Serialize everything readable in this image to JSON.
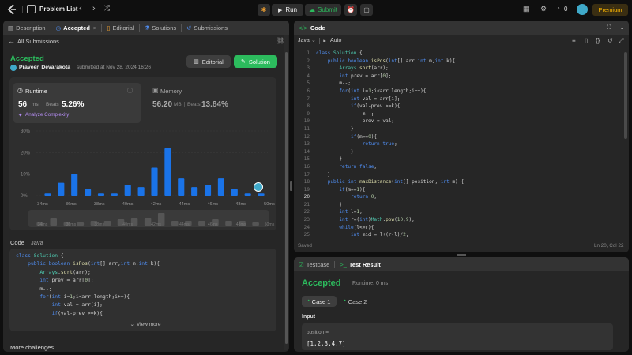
{
  "topbar": {
    "problem_list": "Problem List",
    "run": "Run",
    "submit": "Submit",
    "coins": "0",
    "premium": "Premium"
  },
  "left_tabs": {
    "description": "Description",
    "accepted": "Accepted",
    "editorial": "Editorial",
    "solutions": "Solutions",
    "submissions": "Submissions"
  },
  "sub_header": {
    "back": "All Submissions"
  },
  "result": {
    "status": "Accepted",
    "user": "Praveen Devarakota",
    "submitted": "submitted at Nov 28, 2024 16:26",
    "editorial_btn": "Editorial",
    "solution_btn": "Solution"
  },
  "runtime": {
    "label": "Runtime",
    "value": "56",
    "unit": "ms",
    "beats_label": "Beats",
    "beats": "5.26%",
    "analyze": "Analyze Complexity"
  },
  "memory": {
    "label": "Memory",
    "value": "56.20",
    "unit": "MB",
    "beats_label": "Beats",
    "beats": "13.84%"
  },
  "chart_data": {
    "type": "bar",
    "y_ticks": [
      "30%",
      "20%",
      "10%",
      "0%"
    ],
    "ylim": [
      0,
      30
    ],
    "values": [
      1,
      6,
      10,
      3,
      1,
      1,
      5,
      4,
      13,
      22,
      8,
      4,
      5,
      8,
      3,
      1,
      1
    ],
    "x_labels": [
      "34ms",
      "36ms",
      "38ms",
      "40ms",
      "42ms",
      "44ms",
      "46ms",
      "48ms",
      "50ms"
    ],
    "mini_values": [
      2,
      5,
      2,
      2,
      3,
      3,
      4,
      5,
      5,
      8,
      3,
      3,
      3,
      4,
      3,
      3,
      2
    ]
  },
  "code_section": {
    "label": "Code",
    "lang": "Java",
    "view_more": "View more",
    "lines": [
      "class Solution {",
      "    public boolean isPos(int[] arr,int m,int k){",
      "        Arrays.sort(arr);",
      "        int prev = arr[0];",
      "        m--;",
      "        for(int i=1;i<arr.length;i++){",
      "            int val = arr[i];",
      "            if(val-prev >=k){"
    ]
  },
  "more_challenges": "More challenges",
  "editor": {
    "title": "Code",
    "lang": "Java",
    "auto": "Auto",
    "saved": "Saved",
    "cursor": "Ln 20, Col 22",
    "lines": [
      "class Solution {",
      "    public boolean isPos(int[] arr,int m,int k){",
      "        Arrays.sort(arr);",
      "        int prev = arr[0];",
      "        m--;",
      "        for(int i=1;i<arr.length;i++){",
      "            int val = arr[i];",
      "            if(val-prev >=k){",
      "                m--;",
      "                prev = val;",
      "            }",
      "            if(m==0){",
      "                return true;",
      "            }",
      "        }",
      "        return false;",
      "    }",
      "    public int maxDistance(int[] position, int m) {",
      "        if(m==1){",
      "            return 0;",
      "        }",
      "        int l=1;",
      "        int r=(int)Math.pow(10,9);",
      "        while(l<=r){",
      "            int mid = l+(r-l)/2;"
    ]
  },
  "bottom": {
    "testcase": "Testcase",
    "test_result": "Test Result",
    "status": "Accepted",
    "runtime": "Runtime: 0 ms",
    "case1": "Case 1",
    "case2": "Case 2",
    "input_label": "Input",
    "var": "position =",
    "value": "[1,2,3,4,7]"
  }
}
